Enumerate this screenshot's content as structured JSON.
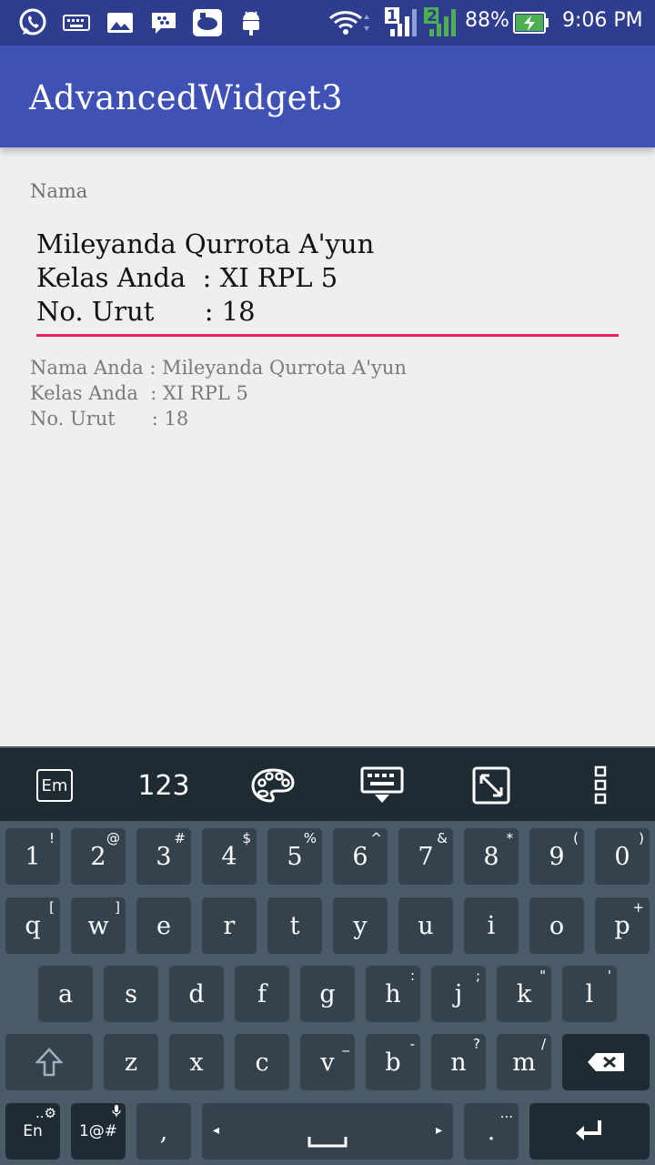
{
  "status_bar": {
    "battery": "88%",
    "time": "9:06 PM",
    "sim1": "1",
    "sim2": "2"
  },
  "app": {
    "title": "AdvancedWidget3"
  },
  "form": {
    "label": "Nama",
    "input_lines": [
      "Mileyanda Qurrota A'yun",
      "Kelas Anda  : XI RPL 5",
      "No. Urut      : 18"
    ],
    "underline_color": "#e91e63"
  },
  "output": {
    "lines": [
      "Nama Anda : Mileyanda Qurrota A'yun",
      "Kelas Anda  : XI RPL 5",
      "No. Urut      : 18"
    ]
  },
  "keyboard": {
    "toolbar": {
      "emoji": "Em",
      "numbers": "123"
    },
    "row1": [
      {
        "k": "1",
        "s": "!"
      },
      {
        "k": "2",
        "s": "@"
      },
      {
        "k": "3",
        "s": "#"
      },
      {
        "k": "4",
        "s": "$"
      },
      {
        "k": "5",
        "s": "%"
      },
      {
        "k": "6",
        "s": "^"
      },
      {
        "k": "7",
        "s": "&"
      },
      {
        "k": "8",
        "s": "*"
      },
      {
        "k": "9",
        "s": "("
      },
      {
        "k": "0",
        "s": ")"
      }
    ],
    "row2": [
      {
        "k": "q",
        "s": "["
      },
      {
        "k": "w",
        "s": "]"
      },
      {
        "k": "e",
        "s": ""
      },
      {
        "k": "r",
        "s": ""
      },
      {
        "k": "t",
        "s": ""
      },
      {
        "k": "y",
        "s": ""
      },
      {
        "k": "u",
        "s": ""
      },
      {
        "k": "i",
        "s": ""
      },
      {
        "k": "o",
        "s": ""
      },
      {
        "k": "p",
        "s": "+"
      }
    ],
    "row3": [
      {
        "k": "a",
        "s": ""
      },
      {
        "k": "s",
        "s": ""
      },
      {
        "k": "d",
        "s": ""
      },
      {
        "k": "f",
        "s": ""
      },
      {
        "k": "g",
        "s": ""
      },
      {
        "k": "h",
        "s": ":"
      },
      {
        "k": "j",
        "s": ";"
      },
      {
        "k": "k",
        "s": "\""
      },
      {
        "k": "l",
        "s": "'"
      }
    ],
    "row4": [
      {
        "k": "z",
        "s": ""
      },
      {
        "k": "x",
        "s": ""
      },
      {
        "k": "c",
        "s": ""
      },
      {
        "k": "v",
        "s": "_"
      },
      {
        "k": "b",
        "s": "-"
      },
      {
        "k": "n",
        "s": "?"
      },
      {
        "k": "m",
        "s": "/"
      }
    ],
    "lang_key": "En",
    "symbols_key": "1@#",
    "comma_key": ",",
    "period_key": ".",
    "more_hint": "...",
    "lang_hint": "..⚙"
  }
}
